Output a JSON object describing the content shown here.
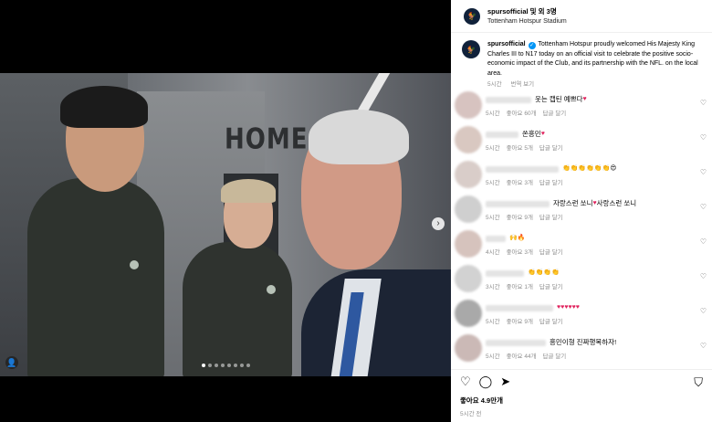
{
  "header": {
    "account_line": "spursofficial 및 외 3명",
    "location": "Tottenham Hotspur Stadium"
  },
  "photo": {
    "wall_text": "HOME",
    "carousel_dots": 8,
    "active_dot": 0
  },
  "caption": {
    "username": "spursofficial",
    "text": "Tottenham Hotspur proudly welcomed His Majesty King Charles III to N17 today on an official visit to celebrate the positive socio-economic impact of the Club, and its partnership with the NFL. on the local area.",
    "time": "5시간",
    "translate": "번역 보기"
  },
  "comments": [
    {
      "text": "웃는 캡틴 예쁘다",
      "emoji": "♥",
      "time": "5시간",
      "likes": "좋아요 60개",
      "reply": "답글 달기",
      "avatar_color": "#d7c3c0"
    },
    {
      "text": "쏜흥민",
      "emoji": "♥",
      "time": "5시간",
      "likes": "좋아요 5개",
      "reply": "답글 달기",
      "avatar_color": "#d9c8c1"
    },
    {
      "text": "",
      "emoji": "👏👏👏👏👏👏😍",
      "time": "5시간",
      "likes": "좋아요 3개",
      "reply": "답글 달기",
      "avatar_color": "#d9cdc9"
    },
    {
      "text": "자랑스런 쏘니",
      "emoji": "♥",
      "text2": "사랑스런 쏘니",
      "time": "5시간",
      "likes": "좋아요 9개",
      "reply": "답글 달기",
      "avatar_color": "#cfcfcf"
    },
    {
      "text": "",
      "emoji": "🙌🔥",
      "time": "4시간",
      "likes": "좋아요 3개",
      "reply": "답글 달기",
      "avatar_color": "#d6c3bd"
    },
    {
      "text": "",
      "emoji": "👏👏👏👏",
      "time": "3시간",
      "likes": "좋아요 1개",
      "reply": "답글 달기",
      "avatar_color": "#d2d2d2"
    },
    {
      "text": "",
      "emoji": "♥♥♥♥♥♥",
      "time": "5시간",
      "likes": "좋아요 9개",
      "reply": "답글 달기",
      "avatar_color": "#a9a9a9"
    },
    {
      "text": "흥민이형 진짜행복하자!",
      "emoji": "",
      "time": "5시간",
      "likes": "좋아요 44개",
      "reply": "답글 달기",
      "avatar_color": "#cbb9b6"
    }
  ],
  "footer": {
    "likes": "좋아요 4.9만개",
    "time": "5시간 전"
  },
  "colors": {
    "verified": "#0095f6",
    "heart": "#e0245e"
  },
  "icons": [
    "heart-icon",
    "comment-icon",
    "share-icon",
    "bookmark-icon",
    "chevron-right-icon",
    "user-tag-icon"
  ]
}
